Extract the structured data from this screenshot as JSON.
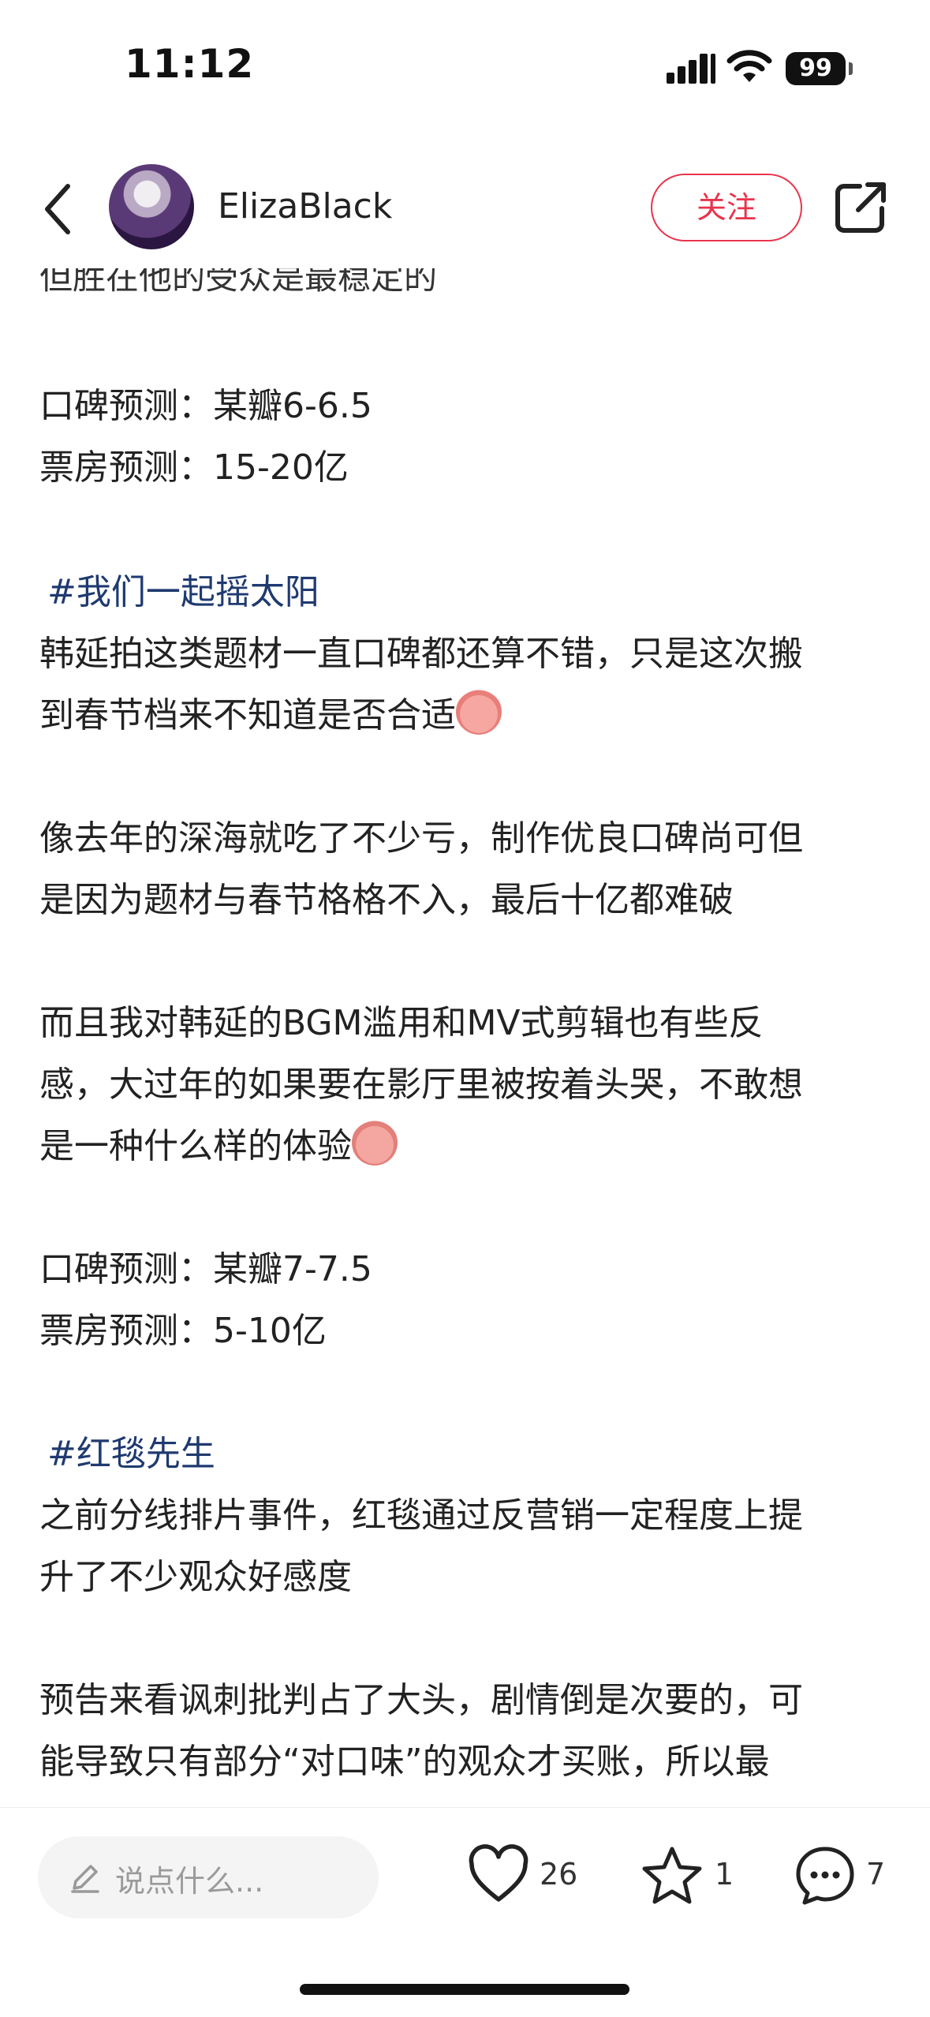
{
  "status": {
    "time": "11:12",
    "battery": "99"
  },
  "header": {
    "username": "ElizaBlack",
    "follow_label": "关注"
  },
  "post": {
    "partial_top": "但胜在他的受众是最稳定的",
    "p1_score": "口碑预测：某瓣6-6.5",
    "p1_box": "票房预测：15-20亿",
    "tag2": "#我们一起摇太阳",
    "p2_l1": "韩延拍这类题材一直口碑都还算不错，只是这次搬",
    "p2_l2": "到春节档来不知道是否合适",
    "p3_l1": "像去年的深海就吃了不少亏，制作优良口碑尚可但",
    "p3_l2": "是因为题材与春节格格不入，最后十亿都难破",
    "p4_l1": "而且我对韩延的BGM滥用和MV式剪辑也有些反",
    "p4_l2": "感，大过年的如果要在影厅里被按着头哭，不敢想",
    "p4_l3": "是一种什么样的体验",
    "p5_score": "口碑预测：某瓣7-7.5",
    "p5_box": "票房预测：5-10亿",
    "tag3": "#红毯先生",
    "p6_l1": "之前分线排片事件，红毯通过反营销一定程度上提",
    "p6_l2": "升了不少观众好感度",
    "p7_l1": "预告来看讽刺批判占了大头，剧情倒是次要的，可",
    "p7_l2": "能导致只有部分“对口味”的观众才买账，所以最"
  },
  "bottom": {
    "comment_placeholder": "说点什么...",
    "likes": "26",
    "favorites": "1",
    "comments": "7"
  },
  "icons": {
    "back": "chevron-left-icon",
    "share": "share-icon",
    "like": "heart-icon",
    "favorite": "star-icon",
    "comment": "comment-bubble-icon",
    "input": "pencil-icon"
  },
  "colors": {
    "accent": "#e8344c",
    "hashtag": "#1f3a70"
  }
}
